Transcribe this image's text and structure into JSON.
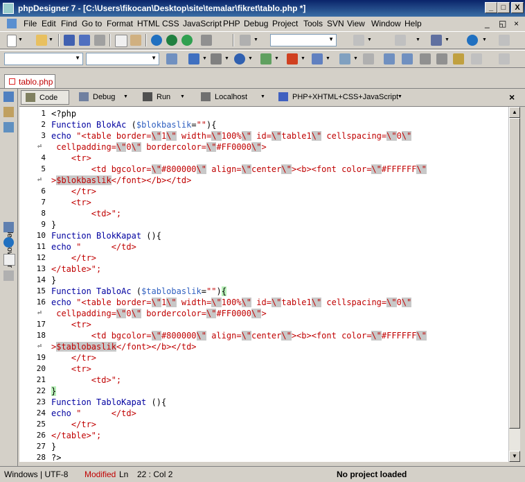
{
  "window": {
    "title": "phpDesigner 7 - [C:\\Users\\fikocan\\Desktop\\site\\temalar\\fikret\\tablo.php *]",
    "minimize": "_",
    "maximize": "□",
    "close": "X"
  },
  "menu": {
    "items": [
      "File",
      "Edit",
      "Find",
      "Go to",
      "Format",
      "HTML",
      "CSS",
      "JavaScript",
      "PHP",
      "Debug",
      "Project",
      "Tools",
      "SVN",
      "View",
      "Window",
      "Help"
    ],
    "mdi_min": "_",
    "mdi_restore": "◱",
    "mdi_close": "×"
  },
  "toolbar": {
    "icons": [
      "new-file-icon",
      "open-folder-icon",
      "save-icon",
      "save-all-icon",
      "copy-icon",
      "paste-icon",
      "globe-preview-icon",
      "css-icon",
      "add-icon",
      "print-icon",
      "cut-icon",
      "undo-icon",
      "redo-icon",
      "cube-icon",
      "globe-icon",
      "export-icon"
    ]
  },
  "tabs": {
    "file": "tablo.php"
  },
  "modes": {
    "code": "Code",
    "debug": "Debug",
    "run": "Run",
    "localhost": "Localhost",
    "language": "PHP+XHTML+CSS+JavaScript",
    "close": "×"
  },
  "sidebar": {
    "label": "File Browser"
  },
  "editor": {
    "line_numbers": [
      "1",
      "2",
      "3",
      "",
      "4",
      "5",
      "",
      "6",
      "7",
      "8",
      "9",
      "10",
      "11",
      "12",
      "13",
      "14",
      "15",
      "16",
      "",
      "17",
      "18",
      "",
      "19",
      "20",
      "21",
      "22",
      "23",
      "24",
      "25",
      "26",
      "27",
      "28"
    ],
    "lines": [
      "<?php",
      "Function BlokAc ($blokbaslik=\"\"){",
      "echo \"<table border=\\\"1\\\" width=\\\"100%\\\" id=\\\"table1\\\" cellspacing=\\\"0\\\"",
      " cellpadding=\\\"0\\\" bordercolor=\\\"#FF0000\\\">",
      "    <tr>",
      "        <td bgcolor=\\\"#800000\\\" align=\\\"center\\\"><b><font color=\\\"#FFFFFF\\\"",
      ">$blokbaslik</font></b></td>",
      "    </tr>",
      "    <tr>",
      "        <td>\";",
      "}",
      "Function BlokKapat (){",
      "echo \"      </td>",
      "    </tr>",
      "</table>\";",
      "}",
      "Function TabloAc ($tablobaslik=\"\"){",
      "echo \"<table border=\\\"1\\\" width=\\\"100%\\\" id=\\\"table1\\\" cellspacing=\\\"0\\\"",
      " cellpadding=\\\"0\\\" bordercolor=\\\"#FF0000\\\">",
      "    <tr>",
      "        <td bgcolor=\\\"#800000\\\" align=\\\"center\\\"><b><font color=\\\"#FFFFFF\\\"",
      ">$tablobaslik</font></b></td>",
      "    </tr>",
      "    <tr>",
      "        <td>\";",
      "}",
      "Function TabloKapat (){",
      "echo \"      </td>",
      "    </tr>",
      "</table>\";",
      "}",
      "?>"
    ]
  },
  "status": {
    "encoding": "Windows | UTF-8",
    "modified": "Modified",
    "ln_label": "Ln",
    "position": "22 : Col  2",
    "project": "No project loaded"
  },
  "colors": {
    "keyword": "#0000a0",
    "string": "#c00000",
    "escape_bg": "#c8c8c8",
    "title_bar": "#0a246a"
  }
}
